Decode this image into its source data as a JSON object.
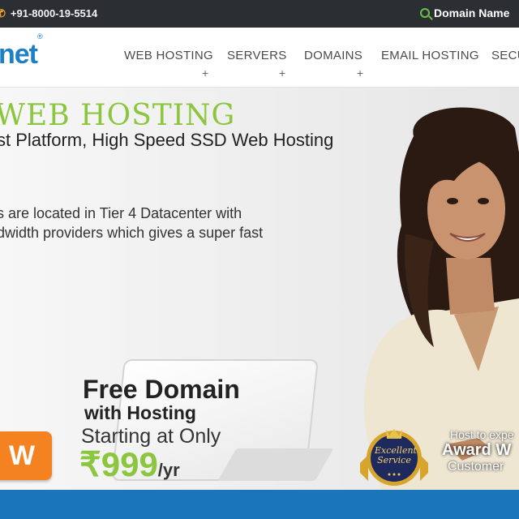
{
  "topbar": {
    "phone": "+91-8000-19-5514",
    "domain_link": "Domain Name"
  },
  "header": {
    "logo": "net",
    "logo_mark": "®",
    "nav": [
      {
        "label": "WEB HOSTING",
        "plus": "+"
      },
      {
        "label": "SERVERS",
        "plus": "+"
      },
      {
        "label": "DOMAINS",
        "plus": "+"
      },
      {
        "label": "EMAIL HOSTING",
        "plus": ""
      },
      {
        "label": "SECU",
        "plus": ""
      }
    ]
  },
  "hero": {
    "title": "WEB HOSTING",
    "subtitle": "st Platform, High Speed SSD Web Hosting",
    "desc_line1": "s are located in Tier 4 Datacenter with",
    "desc_line2": "dwidth providers which gives a super fast",
    "promo": {
      "line1": "Free Domain",
      "line2": "with Hosting",
      "line3": "Starting at Only",
      "price": "₹999",
      "unit": "/yr"
    },
    "button_label": "W",
    "badge": {
      "line1": "Excellent",
      "line2": "Service"
    },
    "award": {
      "line1": "Host to expe",
      "line2": "Award W",
      "line3": "Customer"
    }
  },
  "colors": {
    "accent_green": "#8cc63f",
    "brand_blue": "#1d7fc6",
    "orange": "#f58220",
    "topbar": "#2b2f33"
  },
  "icons": {
    "phone": "phone-icon",
    "search": "search-icon"
  }
}
